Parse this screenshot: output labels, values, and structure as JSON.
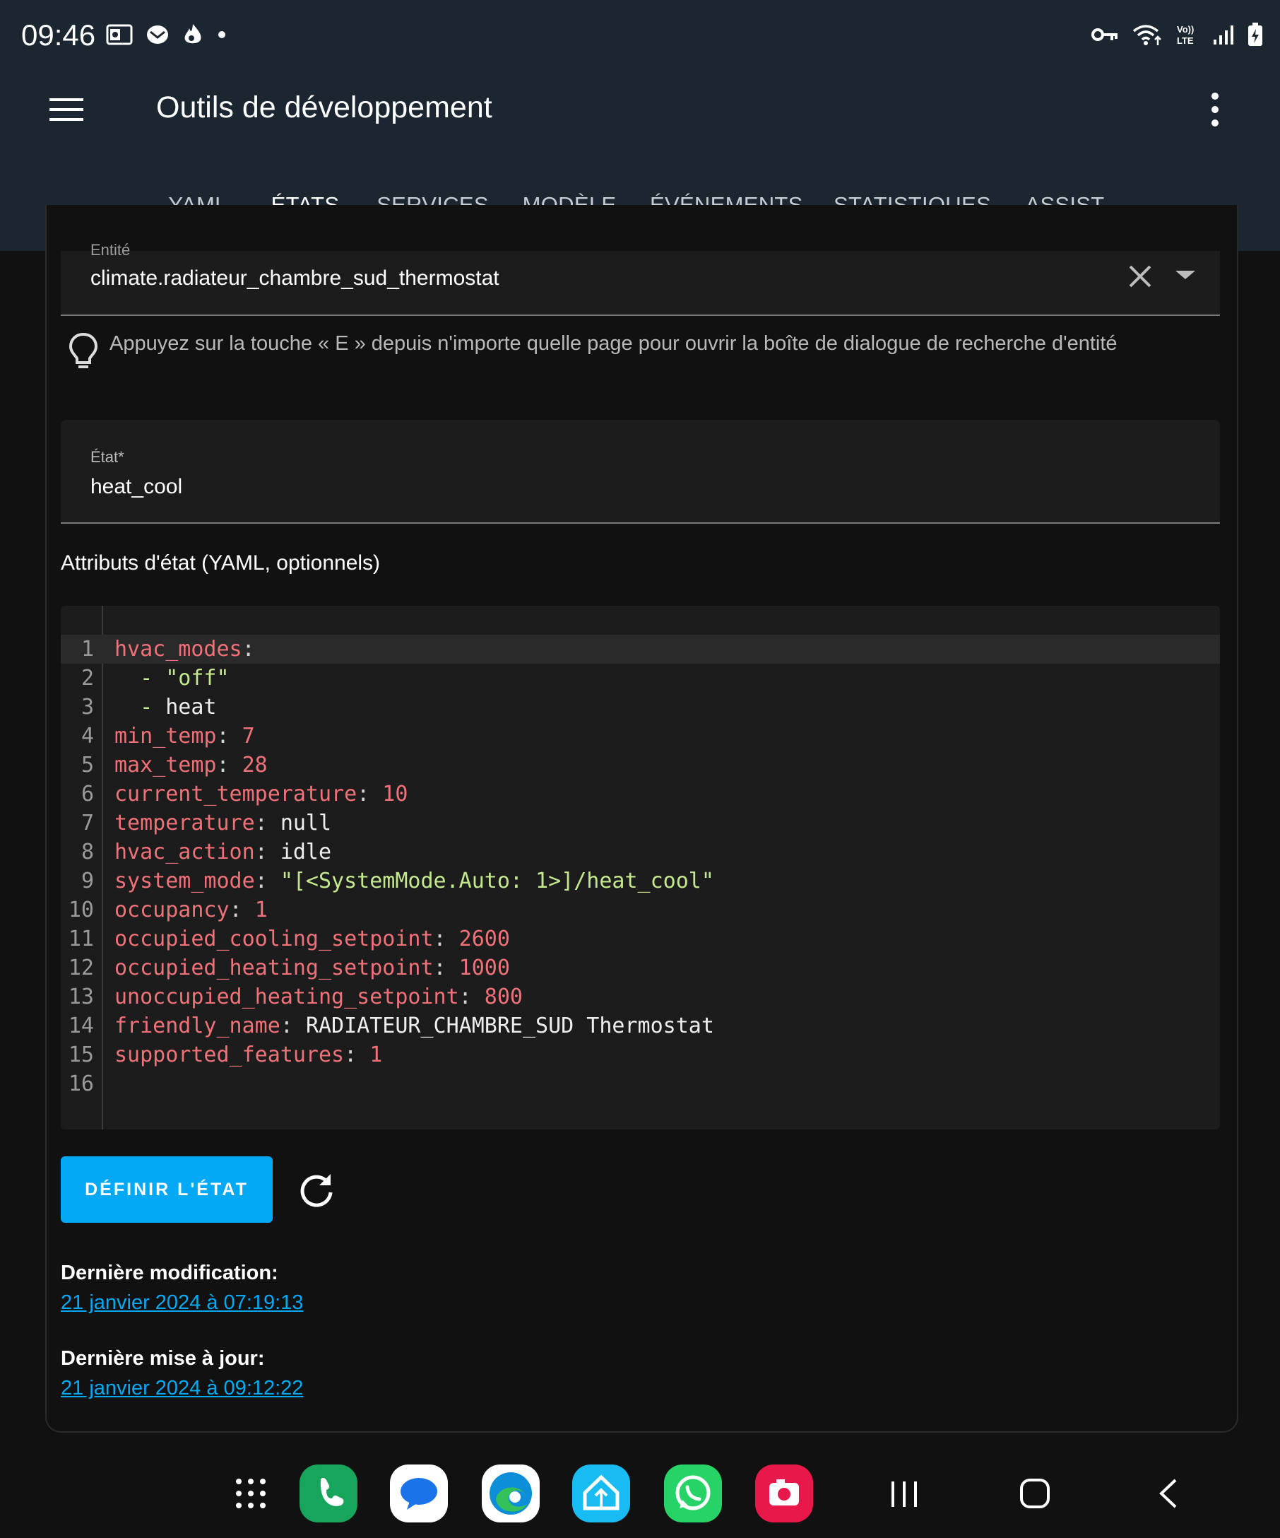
{
  "status_bar": {
    "time": "09:46",
    "left_icons": [
      "outlook-icon",
      "mail-icon",
      "flame-icon",
      "dot-icon"
    ],
    "right_icons": [
      "vpn-key-icon",
      "wifi-icon",
      "volte-icon",
      "signal-icon",
      "battery-icon"
    ]
  },
  "app_bar": {
    "title": "Outils de développement"
  },
  "tabs": [
    {
      "label": "YAML"
    },
    {
      "label": "ÉTATS",
      "active": true
    },
    {
      "label": "SERVICES"
    },
    {
      "label": "MODÈLE"
    },
    {
      "label": "ÉVÉNEMENTS"
    },
    {
      "label": "STATISTIQUES"
    },
    {
      "label": "ASSIST"
    }
  ],
  "entity": {
    "label": "Entité",
    "value": "climate.radiateur_chambre_sud_thermostat"
  },
  "hint": {
    "text": "Appuyez sur la touche « E » depuis n'importe quelle page pour ouvrir la boîte de dialogue de recherche d'entité"
  },
  "state": {
    "label": "État*",
    "value": "heat_cool"
  },
  "attributes": {
    "label": "Attributs d'état (YAML, optionnels)",
    "lines": [
      {
        "n": "1",
        "key": "hvac_modes",
        "value": "",
        "type": "none"
      },
      {
        "n": "2",
        "key": "",
        "value": "\"off\"",
        "type": "list-string"
      },
      {
        "n": "3",
        "key": "",
        "value": "heat",
        "type": "list-text"
      },
      {
        "n": "4",
        "key": "min_temp",
        "value": "7",
        "type": "number"
      },
      {
        "n": "5",
        "key": "max_temp",
        "value": "28",
        "type": "number"
      },
      {
        "n": "6",
        "key": "current_temperature",
        "value": "10",
        "type": "number"
      },
      {
        "n": "7",
        "key": "temperature",
        "value": "null",
        "type": "text"
      },
      {
        "n": "8",
        "key": "hvac_action",
        "value": "idle",
        "type": "text"
      },
      {
        "n": "9",
        "key": "system_mode",
        "value": "\"[<SystemMode.Auto: 1>]/heat_cool\"",
        "type": "string"
      },
      {
        "n": "10",
        "key": "occupancy",
        "value": "1",
        "type": "number"
      },
      {
        "n": "11",
        "key": "occupied_cooling_setpoint",
        "value": "2600",
        "type": "number"
      },
      {
        "n": "12",
        "key": "occupied_heating_setpoint",
        "value": "1000",
        "type": "number"
      },
      {
        "n": "13",
        "key": "unoccupied_heating_setpoint",
        "value": "800",
        "type": "number"
      },
      {
        "n": "14",
        "key": "friendly_name",
        "value": "RADIATEUR_CHAMBRE_SUD Thermostat",
        "type": "text"
      },
      {
        "n": "15",
        "key": "supported_features",
        "value": "1",
        "type": "number"
      },
      {
        "n": "16",
        "key": "",
        "value": "",
        "type": "empty"
      }
    ]
  },
  "actions": {
    "set_state_label": "DÉFINIR L'ÉTAT"
  },
  "meta": {
    "last_changed_label": "Dernière modification:",
    "last_changed_value": "21 janvier 2024 à 07:19:13",
    "last_updated_label": "Dernière mise à jour:",
    "last_updated_value": "21 janvier 2024 à 09:12:22"
  },
  "colors": {
    "app_bar": "#1c2631",
    "accent": "#03a9f4",
    "yaml_key": "#f07178",
    "yaml_string": "#c3e88d"
  },
  "dock_apps": [
    "apps-grid-icon",
    "phone-app-icon",
    "messages-app-icon",
    "edge-browser-icon",
    "home-assistant-icon",
    "whatsapp-icon",
    "screen-recorder-icon"
  ],
  "nav_buttons": [
    "recents-icon",
    "home-icon",
    "back-icon"
  ]
}
